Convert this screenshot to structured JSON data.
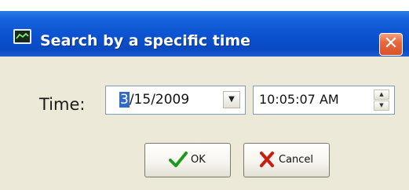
{
  "window": {
    "title": "Search by a specific time",
    "close_label": "✕"
  },
  "form": {
    "time_label": "Time:",
    "date_value_selected": "3",
    "date_value_rest": "/15/2009",
    "date_dropdown_glyph": "▼",
    "time_value": "10:05:07 AM",
    "spin_up_glyph": "▲",
    "spin_down_glyph": "▼"
  },
  "buttons": {
    "ok_label": "OK",
    "cancel_label": "Cancel"
  },
  "icons": {
    "app": "chart-window-icon",
    "close": "close-icon",
    "ok": "check-icon",
    "cancel": "x-icon"
  },
  "colors": {
    "titlebar": "#0b52d0",
    "close_button": "#e8693d",
    "dialog_background": "#ece9d8",
    "selection": "#316ac5",
    "ok_check": "#1c9a1c",
    "cancel_x": "#c81e12"
  }
}
